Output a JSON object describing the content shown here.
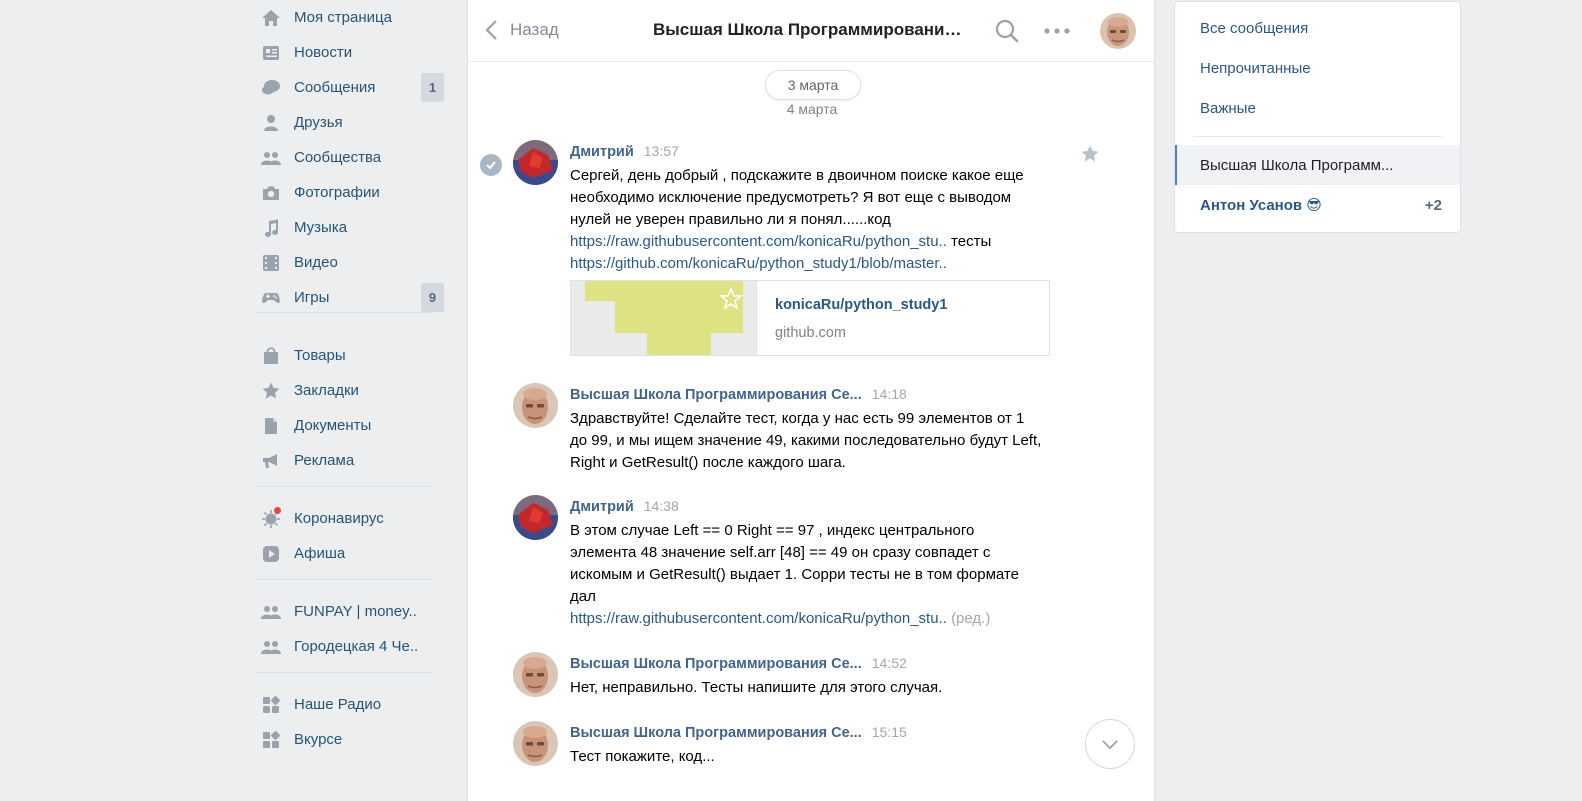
{
  "sidebar": {
    "items": [
      {
        "label": "Моя страница",
        "icon": "home-icon"
      },
      {
        "label": "Новости",
        "icon": "news-icon"
      },
      {
        "label": "Сообщения",
        "icon": "messages-icon",
        "count": "1"
      },
      {
        "label": "Друзья",
        "icon": "friend-icon"
      },
      {
        "label": "Сообщества",
        "icon": "groups-icon"
      },
      {
        "label": "Фотографии",
        "icon": "camera-icon"
      },
      {
        "label": "Музыка",
        "icon": "music-icon"
      },
      {
        "label": "Видео",
        "icon": "video-icon"
      },
      {
        "label": "Игры",
        "icon": "gamepad-icon",
        "count": "9"
      },
      {
        "label": "Товары",
        "icon": "bag-icon"
      },
      {
        "label": "Закладки",
        "icon": "star-icon"
      },
      {
        "label": "Документы",
        "icon": "document-icon"
      },
      {
        "label": "Реклама",
        "icon": "megaphone-icon"
      },
      {
        "label": "Коронавирус",
        "icon": "virus-icon"
      },
      {
        "label": "Афиша",
        "icon": "play-icon"
      },
      {
        "label": "FUNPAY | money..",
        "icon": "group-icon"
      },
      {
        "label": "Городецкая 4 Че..",
        "icon": "group-icon"
      },
      {
        "label": "Наше Радио",
        "icon": "apps-icon"
      },
      {
        "label": "Вкурсе",
        "icon": "apps-icon"
      }
    ]
  },
  "header": {
    "back_label": "Назад",
    "title": "Высшая Школа Программирования ..."
  },
  "dates": {
    "pill": "3 марта",
    "sub": "4 марта"
  },
  "messages": [
    {
      "author": "Дмитрий",
      "time": "13:57",
      "text": "Сергей, день добрый , подскажите в двоичном поиске какое еще необходимо исключение предусмотреть? Я вот еще с выводом нулей не уверен правильно ли я понял......код",
      "link1": "https://raw.githubusercontent.com/konicaRu/python_stu..",
      "text_after_link1": " тесты",
      "link2": "https://github.com/konicaRu/python_study1/blob/master..",
      "attachment": {
        "title": "konicaRu/python_study1",
        "domain": "github.com"
      }
    },
    {
      "author": "Высшая Школа Программирования Се...",
      "time": "14:18",
      "text": "Здравствуйте! Сделайте тест, когда у нас есть 99 элементов от 1 до 99, и мы ищем значение 49, какими последовательно будут Left, Right и GetResult() после каждого шага."
    },
    {
      "author": "Дмитрий",
      "time": "14:38",
      "text": "В этом случае Left == 0 Right == 97 , индекс центрального элемента 48 значение self.arr [48] == 49 он сразу совпадет с искомым и GetResult() выдает 1. Сорри тесты не в том формате дал",
      "link1": "https://raw.githubusercontent.com/konicaRu/python_stu..",
      "edited": "(ред.)"
    },
    {
      "author": "Высшая Школа Программирования Се...",
      "time": "14:52",
      "text": "Нет, неправильно. Тесты напишите для этого случая."
    },
    {
      "author": "Высшая Школа Программирования Се...",
      "time": "15:15",
      "text": "Тест покажите, код..."
    }
  ],
  "right_panel": {
    "filters": [
      "Все сообщения",
      "Непрочитанные",
      "Важные"
    ],
    "active_chat": "Высшая Школа Программ...",
    "other_chat": "Антон Усанов 😎",
    "other_chat_badge": "+2"
  },
  "colors": {
    "background": "#edeef0",
    "link": "#2a5885",
    "author": "#42648b",
    "sidebar_text": "#285473",
    "icon": "#99a2ad"
  }
}
